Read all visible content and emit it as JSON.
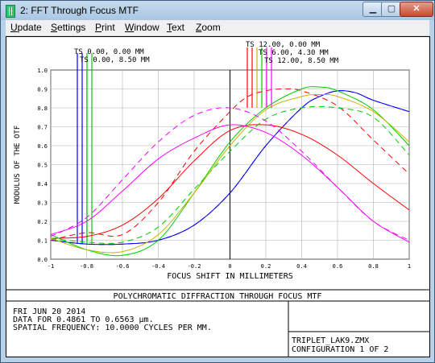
{
  "window": {
    "title": "2: FFT Through Focus MTF",
    "buttons": {
      "minimize": "▁",
      "maximize": "▢",
      "close": "✕"
    }
  },
  "menu": {
    "items": [
      "Update",
      "Settings",
      "Print",
      "Window",
      "Text",
      "Zoom"
    ]
  },
  "chart_data": {
    "type": "line",
    "xlabel": "FOCUS SHIFT IN MILLIMETERS",
    "ylabel": "MODULUS OF THE OTF",
    "xlim": [
      -1,
      1
    ],
    "ylim": [
      0,
      1
    ],
    "x_ticks": [
      "-1",
      "-0.8",
      "-0.6",
      "-0.4",
      "-0.2",
      "0",
      "0.2",
      "0.4",
      "0.6",
      "0.8",
      "1"
    ],
    "y_ticks": [
      "0.0",
      "0.1",
      "0.2",
      "0.3",
      "0.4",
      "0.5",
      "0.6",
      "0.7",
      "0.8",
      "0.9",
      "1.0"
    ],
    "grid": true,
    "legend_left": [
      "TS 0.00, 0.00 MM",
      "TS 0.00, 8.50 MM"
    ],
    "legend_right": [
      "TS 12.00, 0.00 MM",
      "TS 6.00, 4.30 MM",
      "TS 12.00, 8.50 MM"
    ],
    "series": [
      {
        "color": "#0000ff",
        "style": "solid",
        "x": [
          -1,
          -0.8,
          -0.6,
          -0.4,
          -0.2,
          0,
          0.2,
          0.4,
          0.5,
          0.6,
          0.7,
          0.8,
          1
        ],
        "y": [
          0.1,
          0.08,
          0.08,
          0.1,
          0.18,
          0.35,
          0.6,
          0.8,
          0.86,
          0.89,
          0.88,
          0.84,
          0.78
        ]
      },
      {
        "color": "#0000ff",
        "style": "dash",
        "x": [
          -1,
          -0.8,
          -0.6,
          -0.4,
          -0.2,
          0,
          0.2,
          0.4,
          0.5,
          0.6,
          0.7,
          0.8,
          1
        ],
        "y": [
          0.1,
          0.08,
          0.08,
          0.1,
          0.18,
          0.35,
          0.6,
          0.8,
          0.86,
          0.89,
          0.88,
          0.84,
          0.78
        ]
      },
      {
        "color": "#ff0000",
        "style": "solid",
        "x": [
          -1,
          -0.8,
          -0.6,
          -0.4,
          -0.2,
          0,
          0.2,
          0.4,
          0.6,
          0.8,
          1
        ],
        "y": [
          0.11,
          0.12,
          0.18,
          0.32,
          0.52,
          0.68,
          0.71,
          0.66,
          0.55,
          0.4,
          0.26
        ]
      },
      {
        "color": "#ff0000",
        "style": "dash",
        "x": [
          -1,
          -0.8,
          -0.6,
          -0.4,
          -0.2,
          0,
          0.1,
          0.2,
          0.3,
          0.4,
          0.6,
          0.8,
          1
        ],
        "y": [
          0.1,
          0.14,
          0.13,
          0.3,
          0.57,
          0.78,
          0.86,
          0.89,
          0.9,
          0.89,
          0.81,
          0.63,
          0.45
        ]
      },
      {
        "color": "#00cc00",
        "style": "solid",
        "x": [
          -1,
          -0.8,
          -0.6,
          -0.4,
          -0.2,
          0,
          0.2,
          0.4,
          0.5,
          0.6,
          0.8,
          1
        ],
        "y": [
          0.13,
          0.05,
          0.02,
          0.1,
          0.35,
          0.62,
          0.8,
          0.9,
          0.91,
          0.89,
          0.79,
          0.6
        ]
      },
      {
        "color": "#00cc00",
        "style": "dash",
        "x": [
          -1,
          -0.8,
          -0.6,
          -0.4,
          -0.2,
          0,
          0.2,
          0.4,
          0.6,
          0.8,
          1
        ],
        "y": [
          0.11,
          0.09,
          0.09,
          0.17,
          0.37,
          0.57,
          0.74,
          0.8,
          0.8,
          0.75,
          0.55
        ]
      },
      {
        "color": "#c8b400",
        "style": "solid",
        "x": [
          -1,
          -0.8,
          -0.6,
          -0.4,
          -0.2,
          0,
          0.2,
          0.4,
          0.5,
          0.6,
          0.8,
          1
        ],
        "y": [
          0.11,
          0.05,
          0.04,
          0.13,
          0.35,
          0.6,
          0.79,
          0.86,
          0.87,
          0.86,
          0.78,
          0.62
        ]
      },
      {
        "color": "#ff00ff",
        "style": "solid",
        "x": [
          -1,
          -0.8,
          -0.6,
          -0.4,
          -0.2,
          0,
          0.2,
          0.4,
          0.6,
          0.8,
          1
        ],
        "y": [
          0.13,
          0.2,
          0.36,
          0.53,
          0.64,
          0.71,
          0.67,
          0.55,
          0.38,
          0.2,
          0.09
        ]
      },
      {
        "color": "#ff00ff",
        "style": "dash",
        "x": [
          -1,
          -0.8,
          -0.6,
          -0.4,
          -0.2,
          0,
          0.2,
          0.4,
          0.6,
          0.8,
          1
        ],
        "y": [
          0.12,
          0.22,
          0.42,
          0.62,
          0.76,
          0.8,
          0.73,
          0.57,
          0.38,
          0.2,
          0.1
        ]
      }
    ]
  },
  "footer": {
    "title": "POLYCHROMATIC DIFFRACTION THROUGH FOCUS MTF",
    "date": "FRI JUN 20 2014",
    "data_for": "DATA FOR 0.4861 TO 0.6563 μm.",
    "spatial": "SPATIAL FREQUENCY: 10.0000 CYCLES PER MM.",
    "file": "TRIPLET_LAK9.ZMX",
    "config": "CONFIGURATION 1 OF 2"
  },
  "colors": {
    "accent_blue": "#0000ff",
    "red": "#ff0000",
    "green": "#00cc00",
    "yellow": "#c8b400",
    "magenta": "#ff00ff"
  }
}
